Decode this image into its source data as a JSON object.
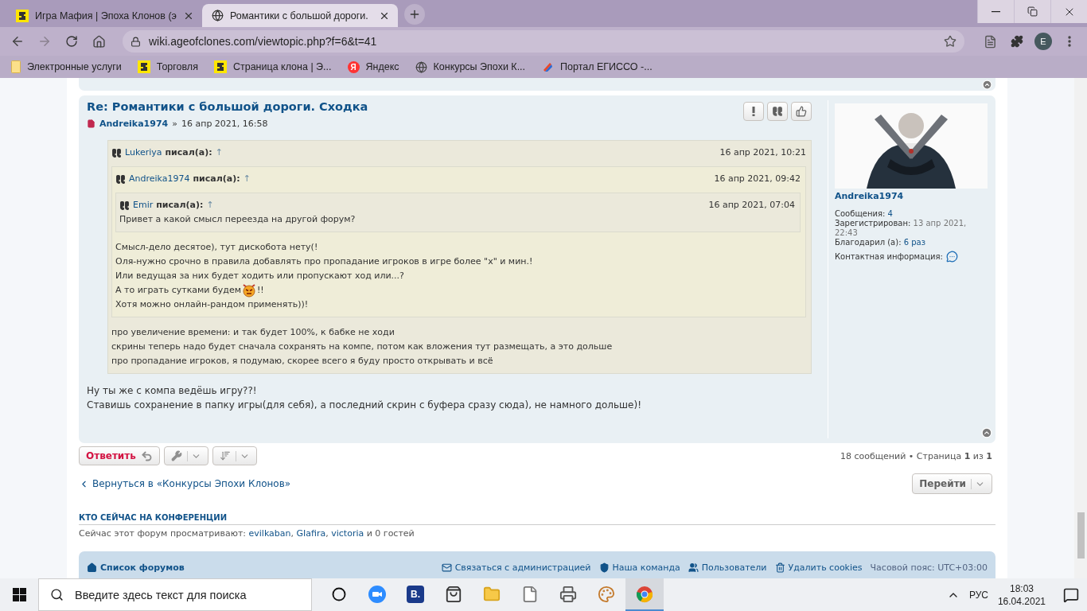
{
  "browser": {
    "tabs": [
      {
        "title": "Игра Мафия | Эпоха Клонов (э",
        "kind": "logo",
        "selected": false
      },
      {
        "title": "Романтики с большой дороги.",
        "kind": "globe",
        "selected": true
      }
    ],
    "address": "wiki.ageofclones.com/viewtopic.php?f=6&t=41",
    "profile_letter": "E",
    "bookmarks": [
      {
        "label": "Электронные услуги",
        "kind": "folder"
      },
      {
        "label": "Торговля",
        "kind": "logo"
      },
      {
        "label": "Страница клона | Э...",
        "kind": "logo"
      },
      {
        "label": "Яндекс",
        "kind": "letter",
        "letter": "Я"
      },
      {
        "label": "Конкурсы Эпохи К...",
        "kind": "globe"
      },
      {
        "label": "Портал ЕГИССО -...",
        "kind": "portal"
      }
    ]
  },
  "post": {
    "title": "Re: Романтики с большой дороги. Сходка",
    "author": "Andreika1974",
    "separator": "»",
    "date": "16 апр 2021, 16:58",
    "quote": {
      "author": "Lukeriya",
      "said": "писал(а):",
      "arrow": "↑",
      "date": "16 апр 2021, 10:21",
      "quote": {
        "author": "Andreika1974",
        "said": "писал(а):",
        "arrow": "↑",
        "date": "16 апр 2021, 09:42",
        "quote": {
          "author": "Emir",
          "said": "писал(а):",
          "arrow": "↑",
          "date": "16 апр 2021, 07:04",
          "lines": [
            {
              "kind": "text",
              "text": "Привет а какой смысл переезда на другой форум?"
            }
          ]
        },
        "lines": [
          {
            "kind": "text",
            "text": "Смысл-дело десятое), тут дискобота нету(!"
          },
          {
            "kind": "text",
            "text": "Оля-нужно срочно в правила добавлять про пропадание игроков в игре более \"х\" и мин.!"
          },
          {
            "kind": "text",
            "text": "Или ведущая за них будет ходить или пропускают ход или...?"
          },
          {
            "kind": "smiley",
            "text": "А то играть сутками будем",
            "after": "!!"
          },
          {
            "kind": "text",
            "text": "Хотя можно онлайн-рандом применять))!"
          }
        ]
      },
      "lines": [
        {
          "kind": "text",
          "text": "про увеличение времени: и так будет 100%, к бабке не ходи"
        },
        {
          "kind": "text",
          "text": "скрины теперь надо будет сначала сохранять на компе, потом как вложения тут размещать, а это дольше"
        },
        {
          "kind": "text",
          "text": "про пропадание игроков, я подумаю, скорее всего я буду просто открывать и всё"
        }
      ]
    },
    "body": [
      "Ну ты же с компа ведёшь игру??!",
      "Ставишь сохранение в папку игры(для себя), а последний скрин с буфера сразу сюда), не намного дольше)!"
    ],
    "profile": {
      "username": "Andreika1974",
      "stats": [
        {
          "label": "Сообщения:",
          "value": "4",
          "kind": "link"
        },
        {
          "label": "Зарегистрирован:",
          "value": "13 апр 2021, 22:43",
          "kind": "plain"
        },
        {
          "label": "Благодарил (а):",
          "value": "6 раз",
          "kind": "link"
        },
        {
          "label": "Контактная информация:",
          "kind": "contact"
        }
      ]
    }
  },
  "actions": {
    "reply": "Ответить",
    "pagination": "18 сообщений • Страница **1** из **1**"
  },
  "back_link": "Вернуться в «Конкурсы Эпохи Клонов»",
  "jump": "Перейти",
  "online": {
    "heading": "КТО СЕЙЧАС НА КОНФЕРЕНЦИИ",
    "parts": [
      {
        "kind": "text",
        "text": "Сейчас этот форум просматривают: "
      },
      {
        "kind": "link",
        "text": "evilkaban"
      },
      {
        "kind": "text",
        "text": ", "
      },
      {
        "kind": "link",
        "text": "GIafira"
      },
      {
        "kind": "text",
        "text": ", "
      },
      {
        "kind": "link",
        "text": "victoria"
      },
      {
        "kind": "text",
        "text": " и 0 гостей"
      }
    ]
  },
  "footer": {
    "home": "Список форумов",
    "links": [
      {
        "label": "Связаться с администрацией",
        "kind": "mail"
      },
      {
        "label": "Наша команда",
        "kind": "shield"
      },
      {
        "label": "Пользователи",
        "kind": "users"
      },
      {
        "label": "Удалить cookies",
        "kind": "trash"
      }
    ],
    "timezone": "Часовой пояс: UTC+03:00"
  },
  "taskbar": {
    "search": {
      "placeholder": "Введите здесь текст для поиска"
    },
    "apps": [
      {
        "kind": "cortana",
        "selected": false
      },
      {
        "kind": "zoom",
        "selected": false
      },
      {
        "kind": "letter",
        "letter": "B.",
        "selected": false
      },
      {
        "kind": "store",
        "selected": false
      },
      {
        "kind": "folder",
        "selected": false
      },
      {
        "kind": "file",
        "selected": false
      },
      {
        "kind": "printer",
        "selected": false
      },
      {
        "kind": "paint",
        "selected": false
      },
      {
        "kind": "chrome",
        "selected": true
      }
    ],
    "lang": "РУС",
    "time": "18:03",
    "date": "16.04.2021"
  }
}
